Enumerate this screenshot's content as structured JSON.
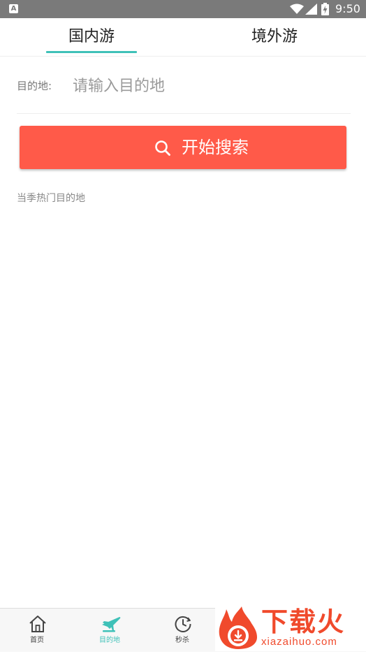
{
  "status_bar": {
    "app_icon_letter": "A",
    "time": "9:50"
  },
  "tabs": {
    "domestic": "国内游",
    "abroad": "境外游",
    "active": "domestic",
    "accent_color": "#3fc1b8"
  },
  "destination": {
    "label": "目的地:",
    "placeholder": "请输入目的地",
    "value": ""
  },
  "search_button": {
    "label": "开始搜索",
    "icon": "search-icon",
    "color": "#ff5a49"
  },
  "hot_destinations": {
    "title": "当季热门目的地"
  },
  "bottom_nav": {
    "items": [
      {
        "label": "首页",
        "icon": "home-icon",
        "active": false
      },
      {
        "label": "目的地",
        "icon": "plane-icon",
        "active": true
      },
      {
        "label": "秒杀",
        "icon": "clock-icon",
        "active": false
      }
    ]
  },
  "watermark": {
    "text": "下载火",
    "domain": "xiazaihuo.com",
    "color": "#f04a2c"
  }
}
